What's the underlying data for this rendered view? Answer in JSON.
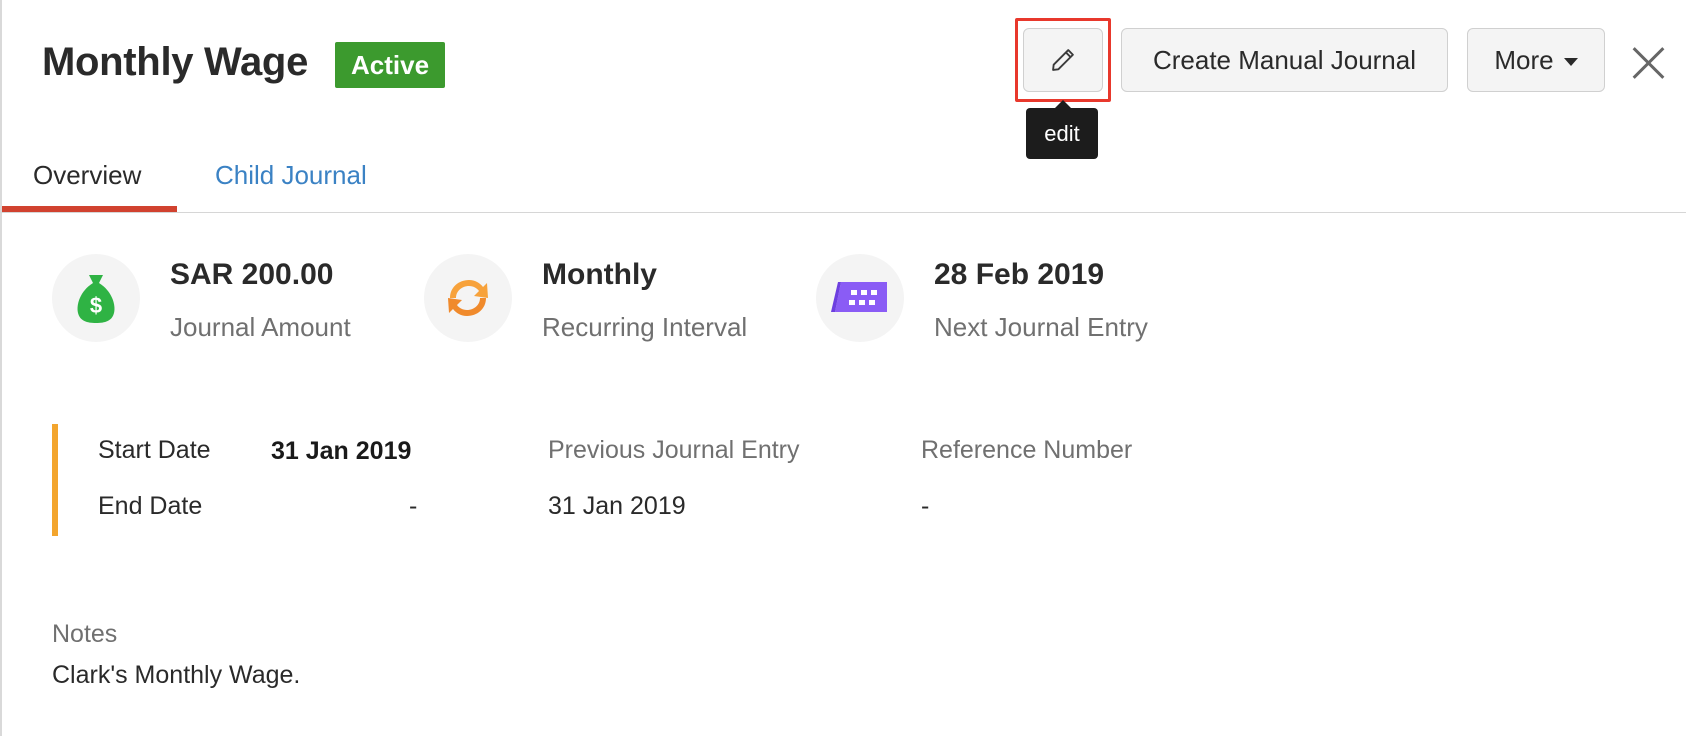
{
  "header": {
    "title": "Monthly Wage",
    "status": "Active",
    "edit_tooltip": "edit",
    "create_manual_journal_label": "Create Manual Journal",
    "more_label": "More"
  },
  "tabs": [
    {
      "label": "Overview",
      "active": true
    },
    {
      "label": "Child Journal",
      "active": false
    }
  ],
  "summary": [
    {
      "value": "SAR 200.00",
      "label": "Journal Amount",
      "icon": "money-bag-icon"
    },
    {
      "value": "Monthly",
      "label": "Recurring Interval",
      "icon": "refresh-cycle-icon"
    },
    {
      "value": "28 Feb 2019",
      "label": "Next Journal Entry",
      "icon": "calendar-icon"
    }
  ],
  "details": {
    "start_date_label": "Start Date",
    "start_date_value": "31 Jan 2019",
    "end_date_label": "End Date",
    "end_date_value": "-",
    "previous_entry_label": "Previous Journal Entry",
    "previous_entry_value": "31 Jan 2019",
    "reference_label": "Reference Number",
    "reference_value": "-"
  },
  "notes": {
    "label": "Notes",
    "text": "Clark's Monthly Wage."
  },
  "colors": {
    "status_active": "#3c9a2e",
    "tab_active_underline": "#d1422f",
    "link_blue": "#3b82c4",
    "details_accent": "#f3a52d",
    "highlight_red": "#e8382c"
  }
}
